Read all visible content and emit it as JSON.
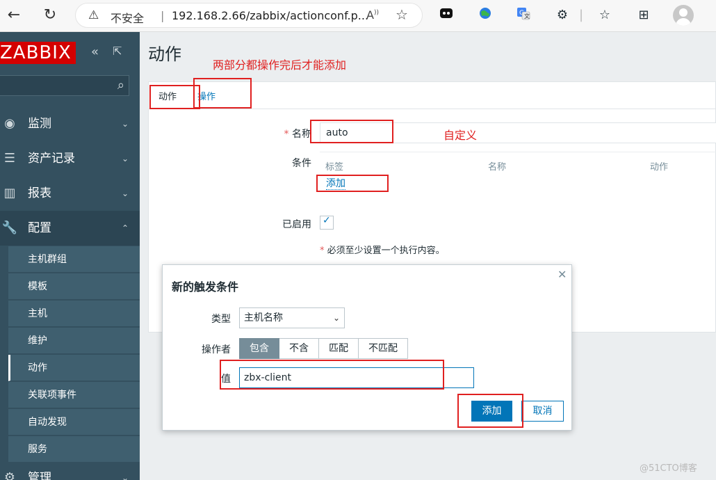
{
  "browser": {
    "back_icon": "back-arrow-icon",
    "reload_icon": "reload-icon",
    "security_text": "不安全",
    "url": "192.168.2.66/zabbix/actionconf.p..."
  },
  "sidebar": {
    "logo": "ZABBIX",
    "menu": [
      {
        "label": "监测",
        "icon": "eye-icon"
      },
      {
        "label": "资产记录",
        "icon": "list-icon"
      },
      {
        "label": "报表",
        "icon": "chart-icon"
      },
      {
        "label": "配置",
        "icon": "wrench-icon"
      },
      {
        "label": "管理",
        "icon": "gear-icon"
      }
    ],
    "submenu": [
      "主机群组",
      "模板",
      "主机",
      "维护",
      "动作",
      "关联项事件",
      "自动发现",
      "服务"
    ]
  },
  "page": {
    "title": "动作",
    "tabs": [
      "动作",
      "操作"
    ],
    "name_label": "名称",
    "name_value": "auto",
    "conditions_label": "条件",
    "cond_headers": [
      "标签",
      "名称",
      "动作"
    ],
    "add_link": "添加",
    "enabled_label": "已启用",
    "note": "必须至少设置一个执行内容。"
  },
  "modal": {
    "title": "新的触发条件",
    "type_label": "类型",
    "type_value": "主机名称",
    "operator_label": "操作者",
    "operators": [
      "包含",
      "不含",
      "匹配",
      "不匹配"
    ],
    "value_label": "值",
    "value": "zbx-client",
    "add_button": "添加",
    "cancel_button": "取消"
  },
  "annotations": {
    "top_note": "两部分都操作完后才能添加",
    "custom_note": "自定义"
  },
  "watermark": "@51CTO博客",
  "colors": {
    "brand": "#d40000",
    "sidebar": "#34505f",
    "accent": "#0275b8",
    "annotation": "#e02020"
  }
}
